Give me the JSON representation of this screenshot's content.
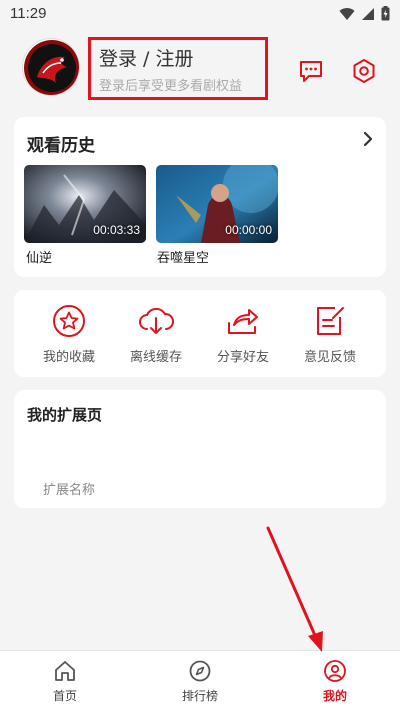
{
  "status": {
    "time": "11:29",
    "icons": [
      "wifi-icon",
      "signal-icon",
      "battery-icon"
    ]
  },
  "profile": {
    "title": "登录 / 注册",
    "subtitle": "登录后享受更多看剧权益",
    "icons": [
      "avatar-dragon-logo",
      "message-icon",
      "settings-icon"
    ]
  },
  "history": {
    "title": "观看历史",
    "items": [
      {
        "name": "仙逆",
        "time": "00:03:33"
      },
      {
        "name": "吞噬星空",
        "time": "00:00:00"
      }
    ]
  },
  "actions": {
    "items": [
      {
        "label": "我的收藏",
        "icon": "star-icon"
      },
      {
        "label": "离线缓存",
        "icon": "cloud-download-icon"
      },
      {
        "label": "分享好友",
        "icon": "share-icon"
      },
      {
        "label": "意见反馈",
        "icon": "feedback-icon"
      }
    ]
  },
  "extension": {
    "title": "我的扩展页",
    "item_label": "扩展名称"
  },
  "tabs": [
    {
      "label": "首页",
      "icon": "home-icon",
      "active": false
    },
    {
      "label": "排行榜",
      "icon": "compass-icon",
      "active": false
    },
    {
      "label": "我的",
      "icon": "user-icon",
      "active": true
    }
  ],
  "colors": {
    "accent": "#e0141e",
    "background": "#f4f4f4",
    "card": "#ffffff"
  }
}
